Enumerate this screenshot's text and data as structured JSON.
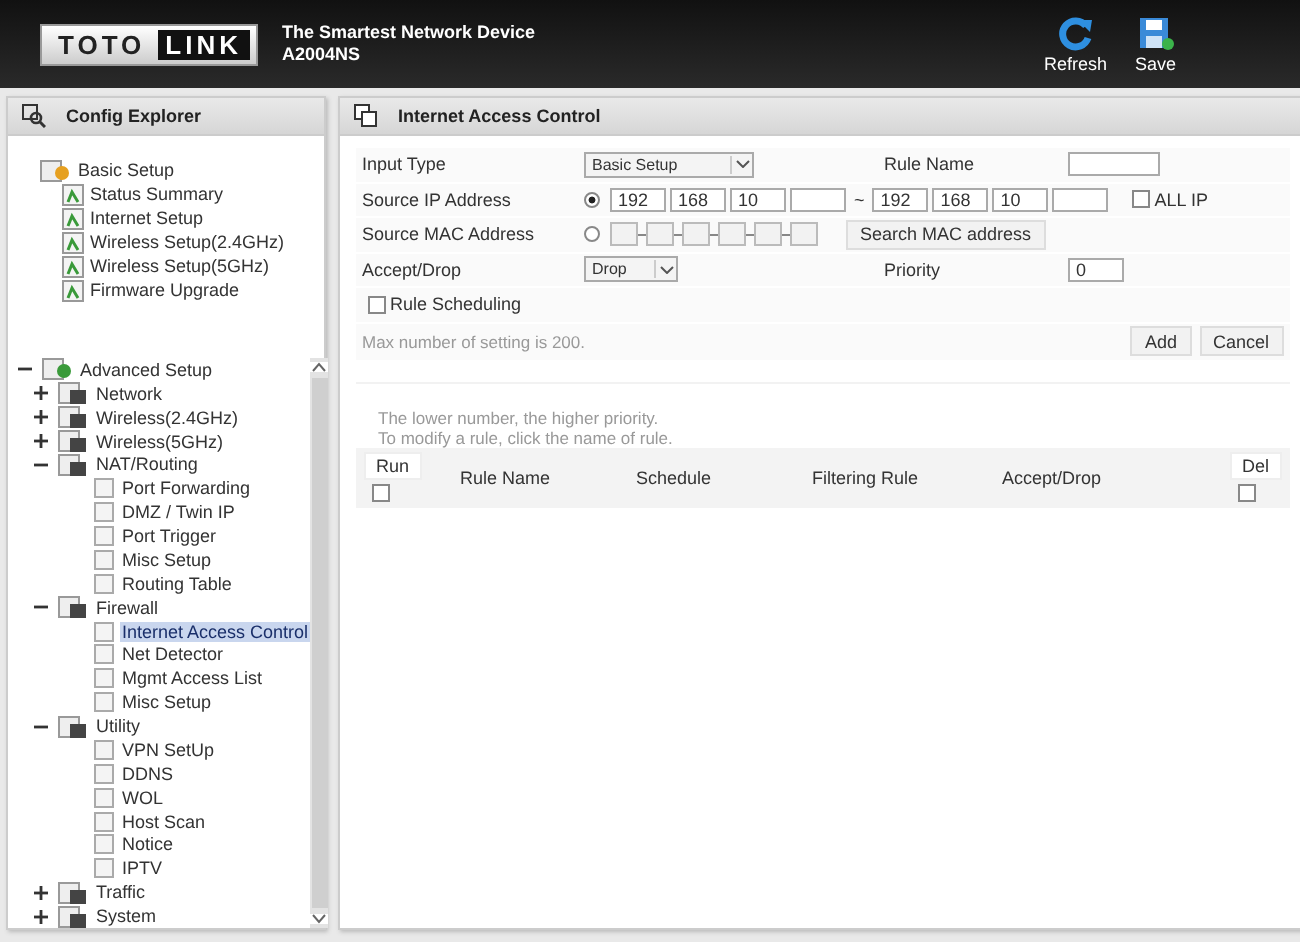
{
  "header": {
    "logo_left": "TOTO",
    "logo_right": "LINK",
    "tagline": "The Smartest Network Device",
    "model": "A2004NS",
    "actions": [
      {
        "label": "Refresh",
        "kind": "refresh"
      },
      {
        "label": "Save",
        "kind": "save"
      }
    ]
  },
  "sidebar": {
    "title": "Config Explorer",
    "basic": {
      "label": "Basic Setup",
      "children": [
        {
          "label": "Status Summary",
          "selected": false
        },
        {
          "label": "Internet Setup",
          "selected": false
        },
        {
          "label": "Wireless Setup(2.4GHz)",
          "selected": false
        },
        {
          "label": "Wireless Setup(5GHz)",
          "selected": false
        },
        {
          "label": "Firmware Upgrade",
          "selected": false
        }
      ]
    },
    "advanced": {
      "label": "Advanced Setup",
      "expanded": true,
      "children": [
        {
          "label": "Network",
          "expanded": false
        },
        {
          "label": "Wireless(2.4GHz)",
          "expanded": false
        },
        {
          "label": "Wireless(5GHz)",
          "expanded": false
        },
        {
          "label": "NAT/Routing",
          "expanded": true,
          "children": [
            {
              "label": "Port Forwarding",
              "selected": false
            },
            {
              "label": "DMZ / Twin IP",
              "selected": false
            },
            {
              "label": "Port Trigger",
              "selected": false
            },
            {
              "label": "Misc Setup",
              "selected": false
            },
            {
              "label": "Routing Table",
              "selected": false
            }
          ]
        },
        {
          "label": "Firewall",
          "expanded": true,
          "children": [
            {
              "label": "Internet Access Control",
              "selected": true
            },
            {
              "label": "Net Detector",
              "selected": false
            },
            {
              "label": "Mgmt Access List",
              "selected": false
            },
            {
              "label": "Misc Setup",
              "selected": false
            }
          ]
        },
        {
          "label": "Utility",
          "expanded": true,
          "children": [
            {
              "label": "VPN SetUp",
              "selected": false
            },
            {
              "label": "DDNS",
              "selected": false
            },
            {
              "label": "WOL",
              "selected": false
            },
            {
              "label": "Host Scan",
              "selected": false
            },
            {
              "label": "Notice",
              "selected": false
            },
            {
              "label": "IPTV",
              "selected": false
            }
          ]
        },
        {
          "label": "Traffic",
          "expanded": false
        },
        {
          "label": "System",
          "expanded": false
        }
      ]
    }
  },
  "panel": {
    "title": "Internet Access Control",
    "input_type": {
      "label": "Input Type",
      "value": "Basic Setup"
    },
    "rule_name": {
      "label": "Rule Name"
    },
    "source_ip": {
      "label": "Source IP Address",
      "selected": true,
      "from": [
        "192",
        "168",
        "10"
      ],
      "separator": "~",
      "to": [
        "192",
        "168",
        "10"
      ],
      "all_ip": {
        "label": "ALL IP",
        "checked": false
      }
    },
    "source_mac": {
      "label": "Source MAC Address",
      "selected": false,
      "search_button": "Search MAC address"
    },
    "accept_drop": {
      "label": "Accept/Drop",
      "value": "Drop"
    },
    "priority": {
      "label": "Priority",
      "value": "0"
    },
    "rule_scheduling": {
      "label": "Rule Scheduling",
      "checked": false
    },
    "max_note": "Max number of setting is 200.",
    "buttons": [
      "Add",
      "Cancel"
    ],
    "notes": [
      "The lower number, the higher priority.",
      "To modify a rule, click the name of rule."
    ],
    "table": {
      "run": {
        "label": "Run",
        "checked": false
      },
      "columns": [
        "Rule Name",
        "Schedule",
        "Filtering Rule",
        "Accept/Drop"
      ],
      "del": {
        "label": "Del",
        "checked": false
      }
    }
  }
}
